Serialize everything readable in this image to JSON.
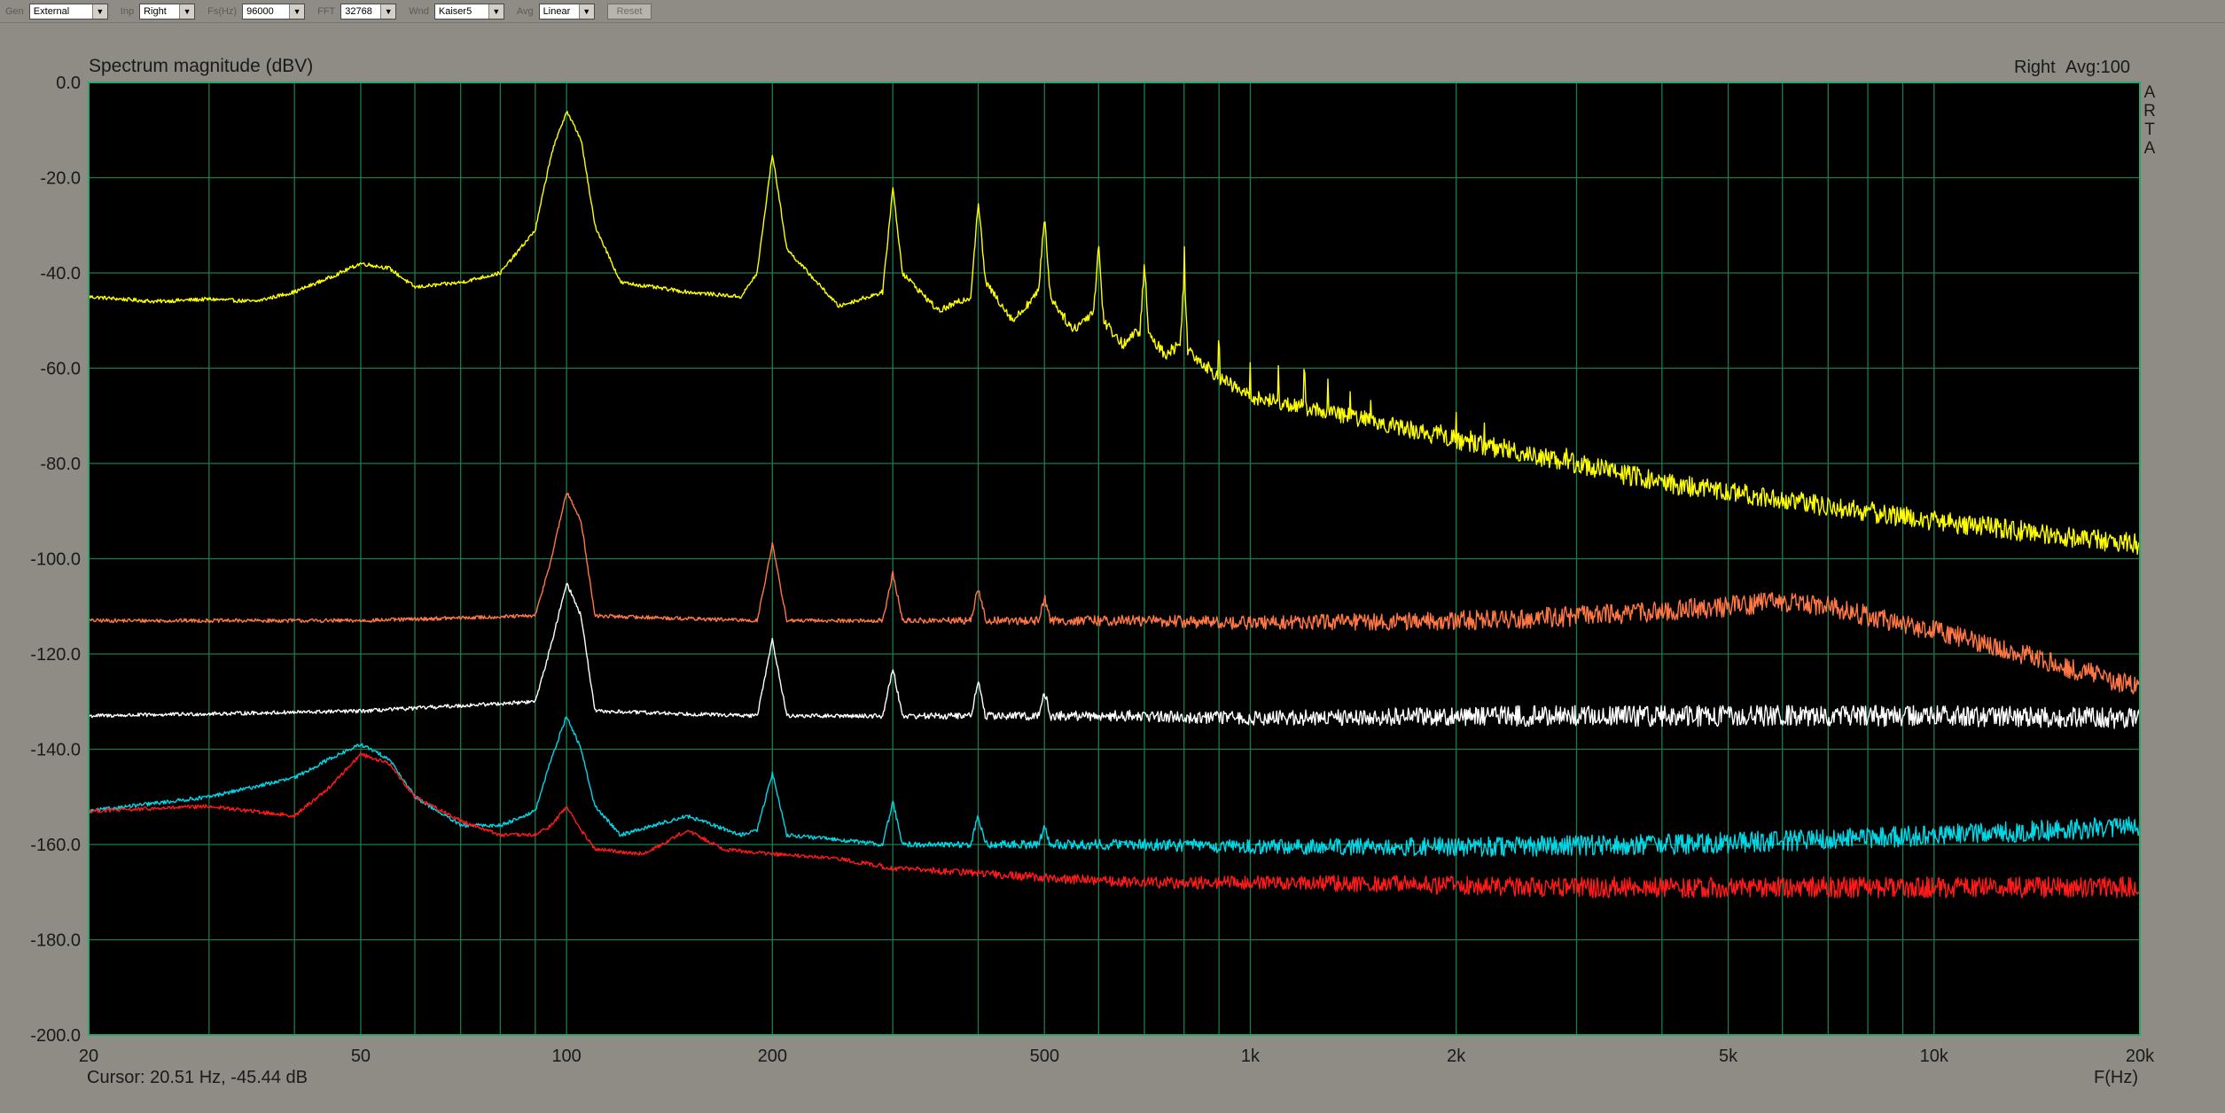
{
  "toolbar": {
    "groups": [
      {
        "label": "Gen",
        "value": "External"
      },
      {
        "label": "Inp",
        "value": "Right"
      },
      {
        "label": "Fs(Hz)",
        "value": "96000"
      },
      {
        "label": "FFT",
        "value": "32768"
      },
      {
        "label": "Wnd",
        "value": "Kaiser5"
      },
      {
        "label": "Avg",
        "value": "Linear"
      }
    ],
    "reset_label": "Reset"
  },
  "chart_info": {
    "channel": "Right",
    "avg": "Avg:100",
    "brand": [
      "A",
      "R",
      "T",
      "A"
    ],
    "cursor": "Cursor: 20.51 Hz, -45.44 dB"
  },
  "colors": {
    "plot_bg": "#000000",
    "grid": "#1e7a4a",
    "frame": "#2aa86a",
    "window_bg": "#8f8b85"
  },
  "chart_data": {
    "type": "line",
    "title": "Spectrum magnitude (dBV)",
    "xlabel": "F(Hz)",
    "ylabel": "",
    "x_scale": "log",
    "xlim": [
      20,
      20000
    ],
    "ylim": [
      -200,
      0
    ],
    "grid": true,
    "yticks": [
      "0.0",
      "-20.0",
      "-40.0",
      "-60.0",
      "-80.0",
      "-100.0",
      "-120.0",
      "-140.0",
      "-160.0",
      "-180.0",
      "-200.0"
    ],
    "xticks": [
      {
        "value": 20,
        "label": "20"
      },
      {
        "value": 50,
        "label": "50"
      },
      {
        "value": 100,
        "label": "100"
      },
      {
        "value": 200,
        "label": "200"
      },
      {
        "value": 500,
        "label": "500"
      },
      {
        "value": 1000,
        "label": "1k"
      },
      {
        "value": 2000,
        "label": "2k"
      },
      {
        "value": 5000,
        "label": "5k"
      },
      {
        "value": 10000,
        "label": "10k"
      },
      {
        "value": 20000,
        "label": "20k"
      }
    ],
    "series": [
      {
        "color": "#ffff00",
        "x": [
          20,
          25,
          30,
          35,
          40,
          45,
          50,
          55,
          60,
          70,
          80,
          90,
          95,
          100,
          105,
          110,
          120,
          150,
          180,
          190,
          200,
          210,
          250,
          290,
          300,
          310,
          350,
          390,
          400,
          410,
          450,
          490,
          500,
          510,
          550,
          590,
          600,
          610,
          650,
          690,
          700,
          710,
          750,
          790,
          800,
          810,
          900,
          1000,
          1500,
          2000,
          3000,
          4000,
          5000,
          7000,
          10000,
          15000,
          20000
        ],
        "y": [
          -45,
          -46,
          -45.5,
          -46,
          -44,
          -41,
          -38,
          -39,
          -43,
          -42,
          -40,
          -31,
          -15,
          -6,
          -12,
          -30,
          -42,
          -44,
          -45,
          -40,
          -15,
          -35,
          -47,
          -44,
          -22,
          -40,
          -48,
          -45,
          -25,
          -42,
          -50,
          -44,
          -28,
          -45,
          -52,
          -48,
          -34,
          -50,
          -55,
          -52,
          -38,
          -53,
          -57,
          -55,
          -40,
          -56,
          -62,
          -66,
          -71,
          -75,
          -80,
          -84,
          -86,
          -89,
          -92,
          -95,
          -97
        ]
      },
      {
        "color": "#ff7744",
        "x": [
          20,
          50,
          90,
          95,
          100,
          105,
          110,
          190,
          200,
          210,
          290,
          300,
          310,
          390,
          400,
          410,
          490,
          500,
          510,
          600,
          700,
          1000,
          2000,
          3000,
          4000,
          5000,
          6000,
          7000,
          8000,
          10000,
          15000,
          20000
        ],
        "y": [
          -113,
          -113,
          -112,
          -100,
          -86,
          -92,
          -112,
          -113,
          -97,
          -113,
          -113,
          -103,
          -113,
          -113,
          -106,
          -113,
          -113,
          -108,
          -113,
          -113,
          -113,
          -113.5,
          -113,
          -112,
          -111,
          -110,
          -109,
          -110,
          -112,
          -115,
          -122,
          -127
        ]
      },
      {
        "color": "#ffffff",
        "x": [
          20,
          50,
          90,
          95,
          100,
          105,
          110,
          190,
          200,
          210,
          290,
          300,
          310,
          390,
          400,
          410,
          490,
          500,
          510,
          700,
          1000,
          2000,
          5000,
          10000,
          20000
        ],
        "y": [
          -133,
          -132,
          -130,
          -118,
          -105,
          -112,
          -132,
          -133,
          -117,
          -133,
          -133,
          -123,
          -133,
          -133,
          -126,
          -133,
          -133,
          -128,
          -133,
          -133,
          -133.5,
          -133,
          -133,
          -133,
          -133.5
        ]
      },
      {
        "color": "#00d8e8",
        "x": [
          20,
          30,
          40,
          45,
          50,
          55,
          60,
          70,
          80,
          90,
          95,
          100,
          105,
          110,
          120,
          150,
          180,
          190,
          200,
          210,
          250,
          290,
          300,
          310,
          390,
          400,
          410,
          490,
          500,
          510,
          700,
          1000,
          2000,
          4000,
          7000,
          10000,
          15000,
          20000
        ],
        "y": [
          -153,
          -150,
          -146,
          -142,
          -139,
          -142,
          -150,
          -156,
          -156,
          -153,
          -142,
          -133,
          -140,
          -152,
          -158,
          -154,
          -158,
          -157,
          -145,
          -158,
          -159,
          -160,
          -151,
          -160,
          -160,
          -154,
          -160,
          -160,
          -156,
          -160,
          -160,
          -160.5,
          -160.5,
          -160,
          -159,
          -158,
          -157,
          -156
        ]
      },
      {
        "color": "#ff1a1a",
        "x": [
          20,
          30,
          40,
          45,
          50,
          55,
          60,
          70,
          80,
          90,
          95,
          100,
          105,
          110,
          130,
          150,
          170,
          200,
          250,
          300,
          400,
          500,
          700,
          1000,
          2000,
          3000,
          5000,
          10000,
          20000
        ],
        "y": [
          -153,
          -152,
          -154,
          -148,
          -141,
          -143,
          -150,
          -155,
          -158,
          -158,
          -156,
          -152,
          -157,
          -161,
          -162,
          -157,
          -161,
          -162,
          -163,
          -165,
          -166,
          -167,
          -168,
          -168,
          -168.5,
          -169,
          -169,
          -169,
          -169
        ]
      }
    ]
  }
}
